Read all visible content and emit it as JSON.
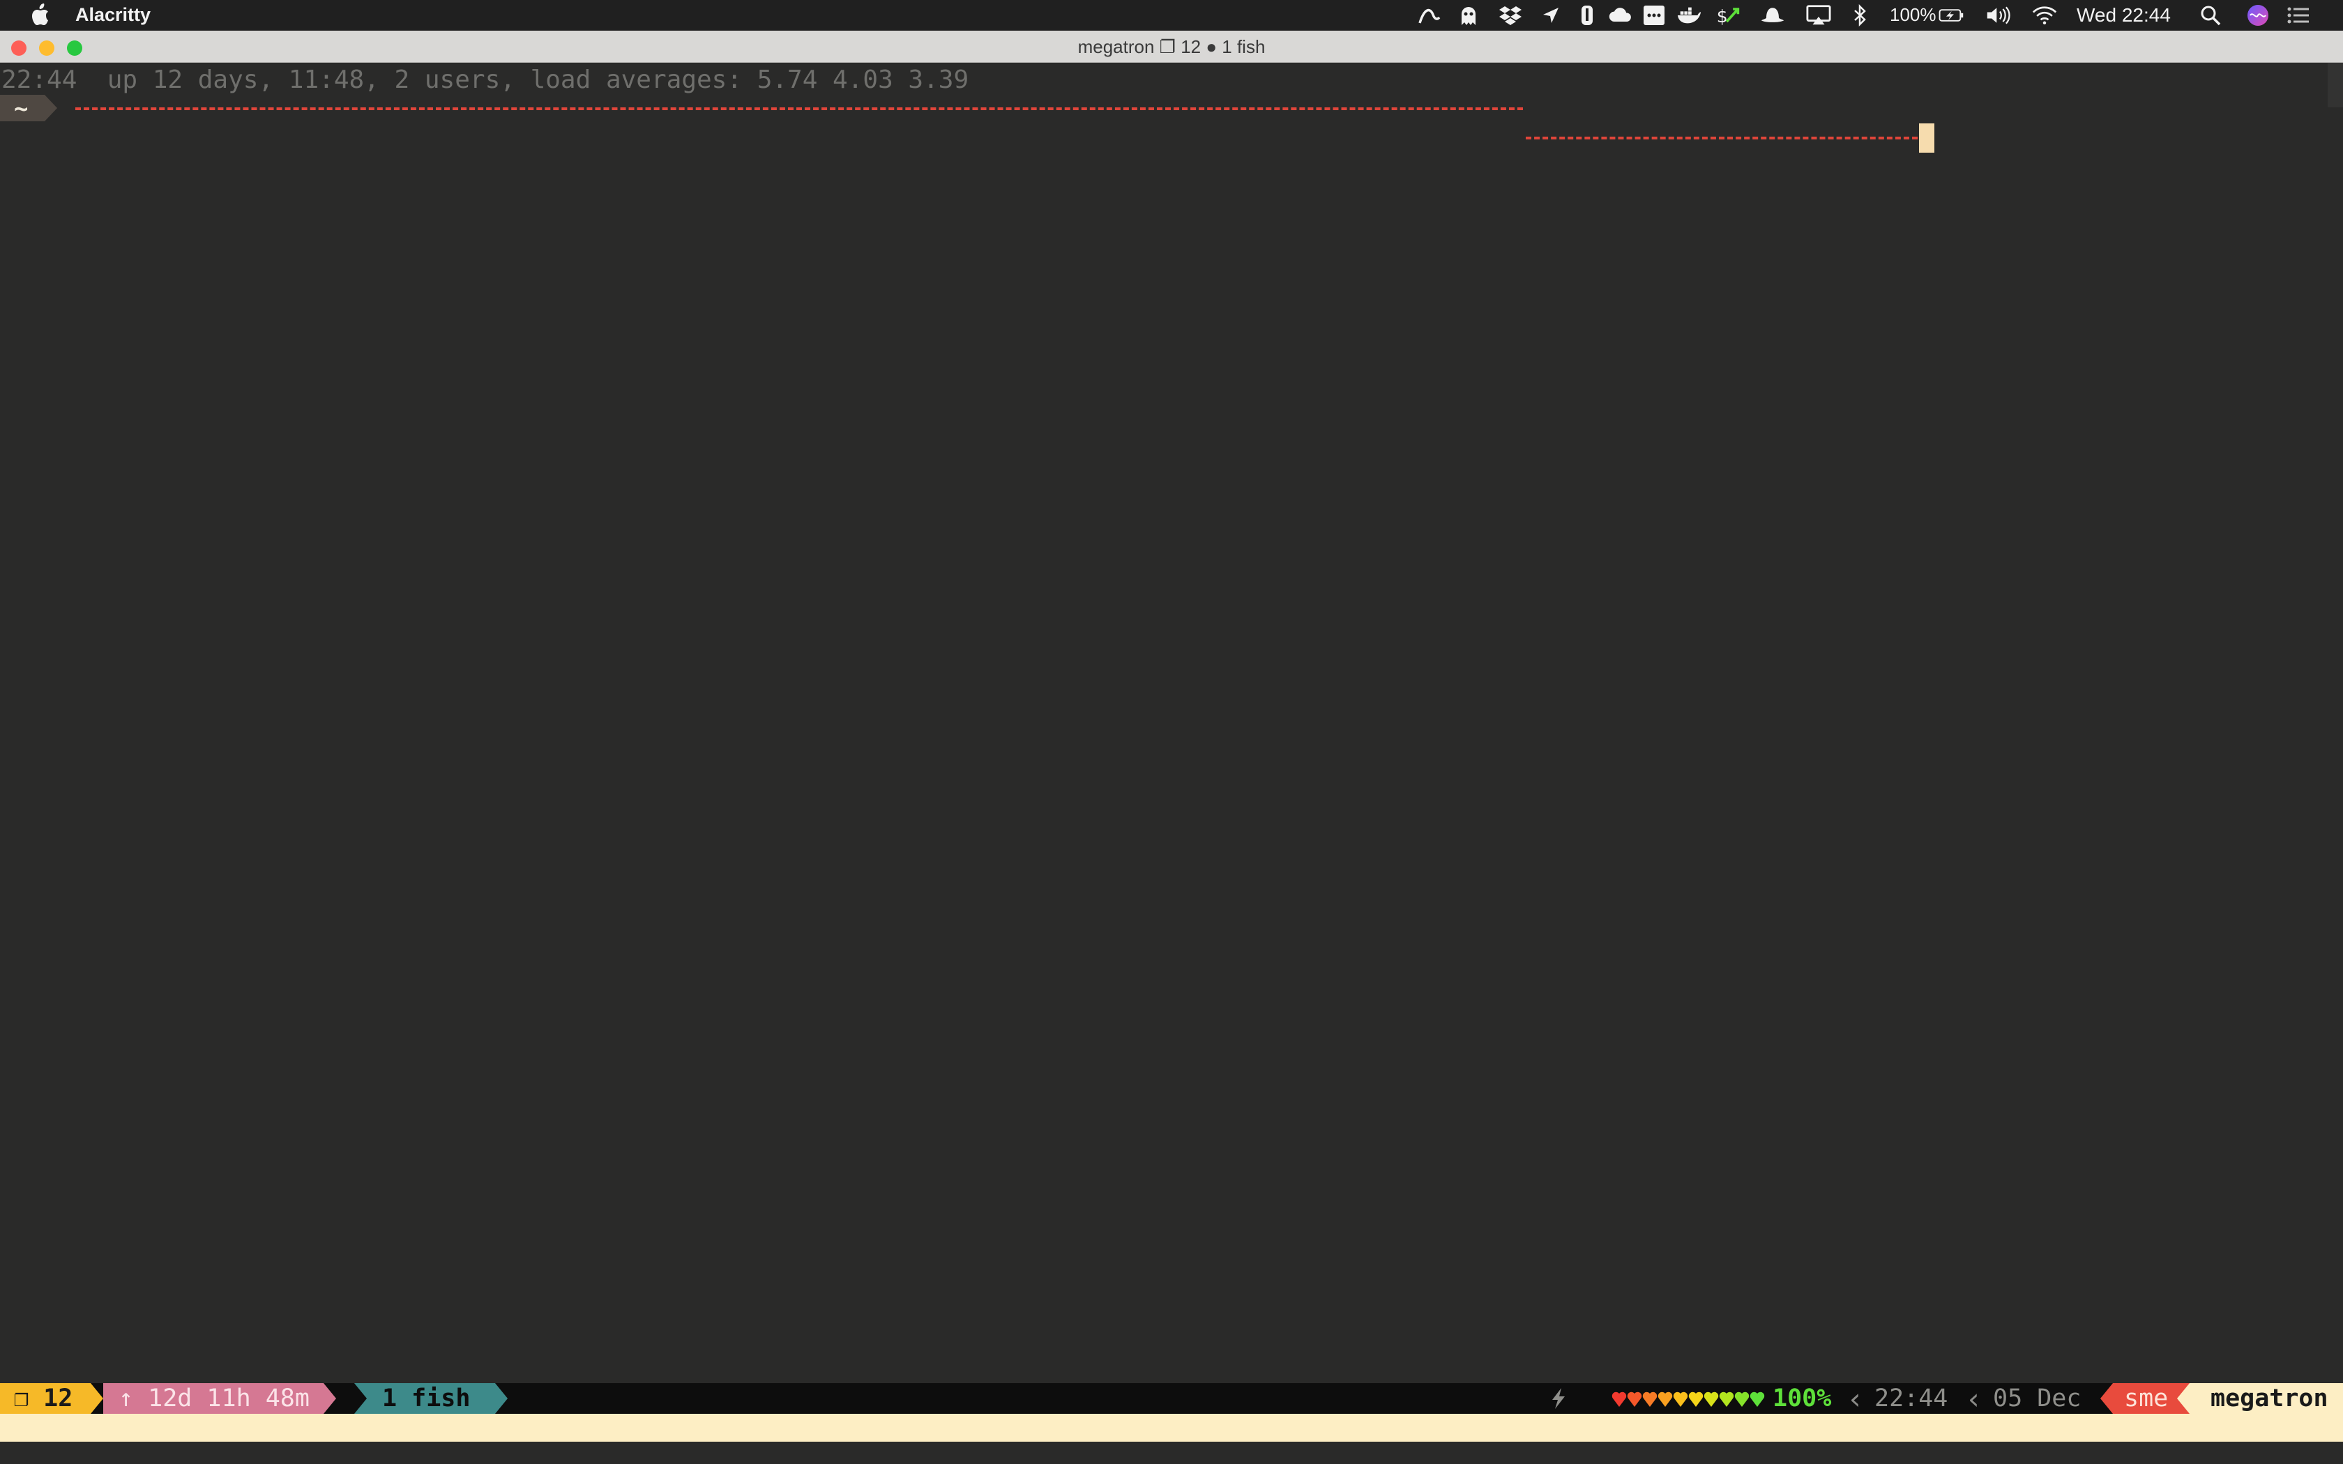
{
  "menubar": {
    "app_name": "Alacritty",
    "battery_percent": "100%",
    "clock": "Wed 22:44",
    "icons": [
      "apple-icon",
      "stylus-icon",
      "ghost-icon",
      "dropbox-icon",
      "location-icon",
      "evernote-icon",
      "cloud-icon",
      "dots-icon",
      "docker-icon",
      "green-s-icon",
      "hat-icon",
      "airplay-icon",
      "bluetooth-icon",
      "battery-icon",
      "volume-icon",
      "wifi-icon",
      "spotlight-icon",
      "siri-icon",
      "notifications-icon"
    ]
  },
  "window": {
    "title": "megatron ❐ 12 ● 1 fish",
    "traffic_lights": {
      "close": "#fd5f57",
      "minimize": "#febc2e",
      "zoom": "#28c840"
    }
  },
  "terminal": {
    "uptime_line": "22:44  up 12 days, 11:48, 2 users, load averages: 5.74 4.03 3.39",
    "prompt_dir": "~",
    "rule_color": "#e0453a",
    "cursor_color": "#f6dcae"
  },
  "statusbar": {
    "session": "❐ 12",
    "uptime": "↑ 12d 11h 48m",
    "window": "1 fish",
    "charging_icon": "lightning-icon",
    "battery_hearts": 10,
    "battery_percent": "100%",
    "time": "22:44",
    "date": "05 Dec",
    "user": "sme",
    "host": "megatron",
    "colors": {
      "session_bg": "#f6b928",
      "uptime_bg": "#d57893",
      "window_bg": "#3d8a8a",
      "user_bg": "#e84b3d",
      "host_bg": "#fdeec4",
      "battery_green": "#5ee03a",
      "muted": "#8f8f8b"
    }
  }
}
